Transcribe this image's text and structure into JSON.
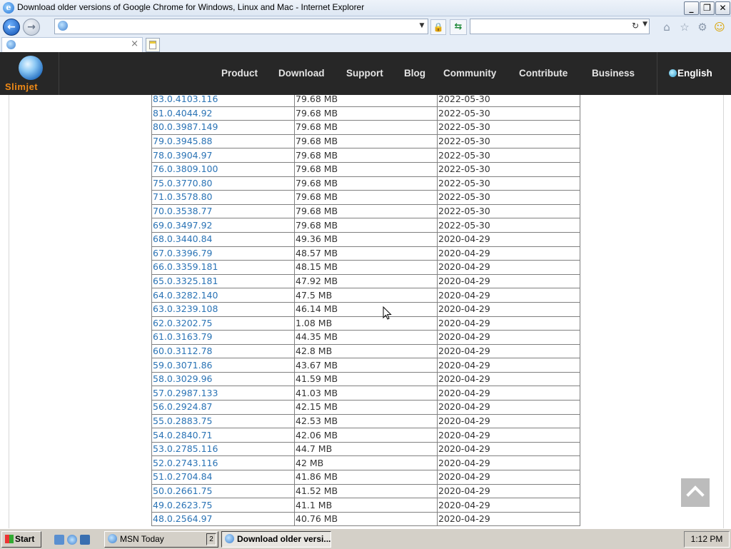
{
  "window": {
    "title": "Download older versions of Google Chrome for Windows, Linux and Mac - Internet Explorer",
    "minimize_glyph": "_",
    "restore_glyph": "❐",
    "close_glyph": "✕"
  },
  "address_bar": {
    "url": ""
  },
  "tab": {
    "title": "",
    "close_glyph": "×"
  },
  "site": {
    "logo_text": "Slimjet",
    "nav": [
      "Product",
      "Download",
      "Support",
      "Blog",
      "Community",
      "Contribute",
      "Business"
    ],
    "language": "English"
  },
  "versions": [
    {
      "version": "83.0.4103.116",
      "size": "79.68 MB",
      "date": "2022-05-30"
    },
    {
      "version": "81.0.4044.92",
      "size": "79.68 MB",
      "date": "2022-05-30"
    },
    {
      "version": "80.0.3987.149",
      "size": "79.68 MB",
      "date": "2022-05-30"
    },
    {
      "version": "79.0.3945.88",
      "size": "79.68 MB",
      "date": "2022-05-30"
    },
    {
      "version": "78.0.3904.97",
      "size": "79.68 MB",
      "date": "2022-05-30"
    },
    {
      "version": "76.0.3809.100",
      "size": "79.68 MB",
      "date": "2022-05-30"
    },
    {
      "version": "75.0.3770.80",
      "size": "79.68 MB",
      "date": "2022-05-30"
    },
    {
      "version": "71.0.3578.80",
      "size": "79.68 MB",
      "date": "2022-05-30"
    },
    {
      "version": "70.0.3538.77",
      "size": "79.68 MB",
      "date": "2022-05-30"
    },
    {
      "version": "69.0.3497.92",
      "size": "79.68 MB",
      "date": "2022-05-30"
    },
    {
      "version": "68.0.3440.84",
      "size": "49.36 MB",
      "date": "2020-04-29"
    },
    {
      "version": "67.0.3396.79",
      "size": "48.57 MB",
      "date": "2020-04-29"
    },
    {
      "version": "66.0.3359.181",
      "size": "48.15 MB",
      "date": "2020-04-29"
    },
    {
      "version": "65.0.3325.181",
      "size": "47.92 MB",
      "date": "2020-04-29"
    },
    {
      "version": "64.0.3282.140",
      "size": "47.5 MB",
      "date": "2020-04-29"
    },
    {
      "version": "63.0.3239.108",
      "size": "46.14 MB",
      "date": "2020-04-29"
    },
    {
      "version": "62.0.3202.75",
      "size": "1.08 MB",
      "date": "2020-04-29"
    },
    {
      "version": "61.0.3163.79",
      "size": "44.35 MB",
      "date": "2020-04-29"
    },
    {
      "version": "60.0.3112.78",
      "size": "42.8 MB",
      "date": "2020-04-29"
    },
    {
      "version": "59.0.3071.86",
      "size": "43.67 MB",
      "date": "2020-04-29"
    },
    {
      "version": "58.0.3029.96",
      "size": "41.59 MB",
      "date": "2020-04-29"
    },
    {
      "version": "57.0.2987.133",
      "size": "41.03 MB",
      "date": "2020-04-29"
    },
    {
      "version": "56.0.2924.87",
      "size": "42.15 MB",
      "date": "2020-04-29"
    },
    {
      "version": "55.0.2883.75",
      "size": "42.53 MB",
      "date": "2020-04-29"
    },
    {
      "version": "54.0.2840.71",
      "size": "42.06 MB",
      "date": "2020-04-29"
    },
    {
      "version": "53.0.2785.116",
      "size": "44.7 MB",
      "date": "2020-04-29"
    },
    {
      "version": "52.0.2743.116",
      "size": "42 MB",
      "date": "2020-04-29"
    },
    {
      "version": "51.0.2704.84",
      "size": "41.86 MB",
      "date": "2020-04-29"
    },
    {
      "version": "50.0.2661.75",
      "size": "41.52 MB",
      "date": "2020-04-29"
    },
    {
      "version": "49.0.2623.75",
      "size": "41.1 MB",
      "date": "2020-04-29"
    },
    {
      "version": "48.0.2564.97",
      "size": "40.76 MB",
      "date": "2020-04-29"
    }
  ],
  "taskbar": {
    "start_label": "Start",
    "items": [
      {
        "label": "MSN Today",
        "count": "2"
      },
      {
        "label": "Download older versi..."
      }
    ],
    "clock": "1:12 PM"
  },
  "colors": {
    "site_header_bg": "#272727",
    "logo_text": "#f08a16",
    "version_link": "#2a73b5",
    "taskbar_bg": "#d4d0c8"
  },
  "icons": {
    "nav_back": "arrow-left-icon",
    "nav_forward": "arrow-right-icon",
    "lock": "lock-icon",
    "refresh": "refresh-icon",
    "home": "home-icon",
    "favorites": "star-icon",
    "tools": "gear-icon",
    "feedback": "smiley-icon",
    "scroll_top": "chevron-up-icon"
  }
}
